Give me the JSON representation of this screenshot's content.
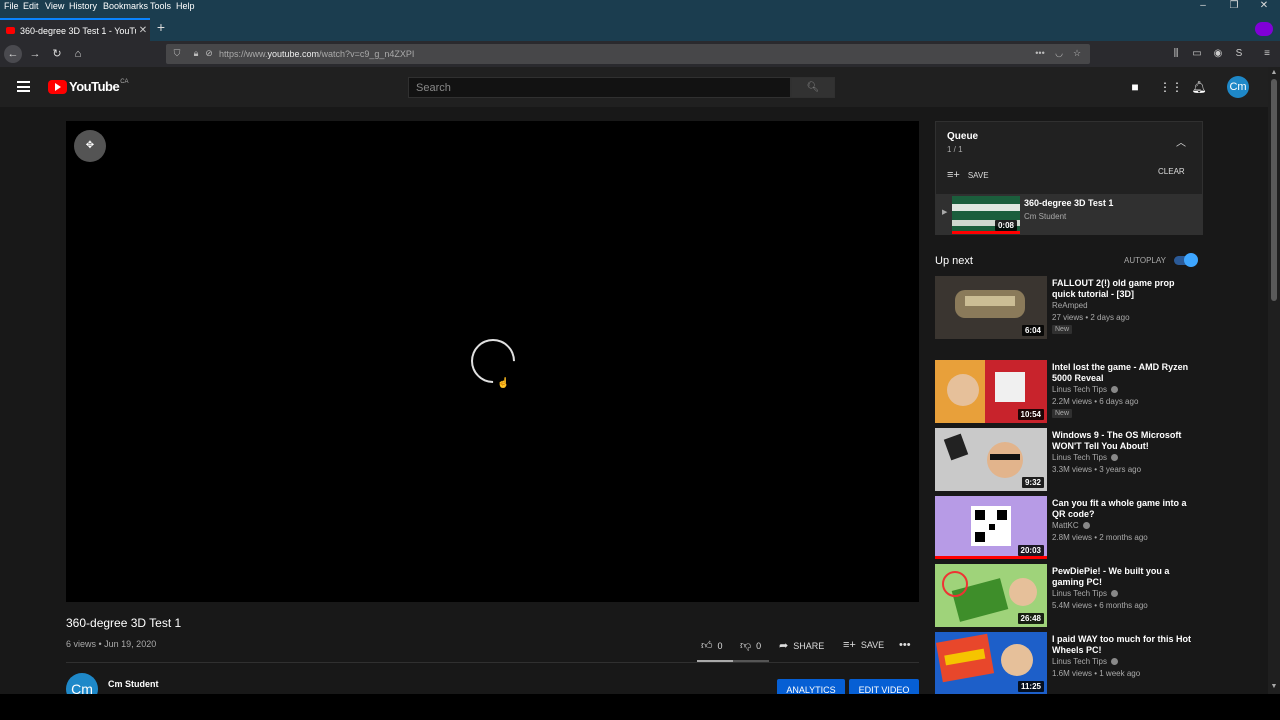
{
  "firefox": {
    "menu": [
      "File",
      "Edit",
      "View",
      "History",
      "Bookmarks",
      "Tools",
      "Help"
    ],
    "tab_title": "360-degree 3D Test 1 - YouTube",
    "new_tab": "+",
    "url_prefix": "https://www.",
    "url_domain": "youtube.com",
    "url_path": "/watch?v=c9_g_n4ZXPI"
  },
  "masthead": {
    "logo_text": "YouTube",
    "country": "CA",
    "search_placeholder": "Search",
    "avatar_initials": "Cm"
  },
  "video": {
    "title": "360-degree 3D Test 1",
    "meta": "6 views • Jun 19, 2020",
    "likes": "0",
    "dislikes": "0",
    "share_label": "SHARE",
    "save_label": "SAVE",
    "sentiment_ratio": 0.5,
    "channel_avatar": "Cm",
    "channel_name": "Cm Student",
    "analytics_label": "ANALYTICS",
    "edit_label": "EDIT VIDEO"
  },
  "queue": {
    "title": "Queue",
    "count": "1 / 1",
    "save_label": "SAVE",
    "clear_label": "CLEAR",
    "item": {
      "title": "360-degree 3D Test 1",
      "channel": "Cm Student",
      "duration": "0:08"
    }
  },
  "upnext": {
    "label": "Up next",
    "autoplay_label": "AUTOPLAY",
    "autoplay_on": true,
    "items": [
      {
        "title": "FALLOUT 2(!) old game prop quick tutorial - [3D]",
        "channel": "ReAmped",
        "meta": "27 views • 2 days ago",
        "duration": "6:04",
        "badge": "New",
        "thumb_color": "#3a3530"
      },
      {
        "title": "Intel lost the game - AMD Ryzen 5000 Reveal",
        "channel": "Linus Tech Tips",
        "meta": "2.2M views • 6 days ago",
        "duration": "10:54",
        "badge": "New",
        "thumb_color": "#c8232c"
      },
      {
        "title": "Windows 9 - The OS Microsoft WON'T Tell You About!",
        "channel": "Linus Tech Tips",
        "meta": "3.3M views • 3 years ago",
        "duration": "9:32",
        "badge": "",
        "thumb_color": "#c9c9c9"
      },
      {
        "title": "Can you fit a whole game into a QR code?",
        "channel": "MattKC",
        "meta": "2.8M views • 2 months ago",
        "duration": "20:03",
        "badge": "",
        "thumb_color": "#b79be6"
      },
      {
        "title": "PewDiePie! - We built you a gaming PC!",
        "channel": "Linus Tech Tips",
        "meta": "5.4M views • 6 months ago",
        "duration": "26:48",
        "badge": "",
        "thumb_color": "#6dbf3a"
      },
      {
        "title": "I paid WAY too much for this Hot Wheels PC!",
        "channel": "Linus Tech Tips",
        "meta": "1.6M views • 1 week ago",
        "duration": "11:25",
        "badge": "",
        "thumb_color": "#1d5fc9"
      }
    ]
  }
}
